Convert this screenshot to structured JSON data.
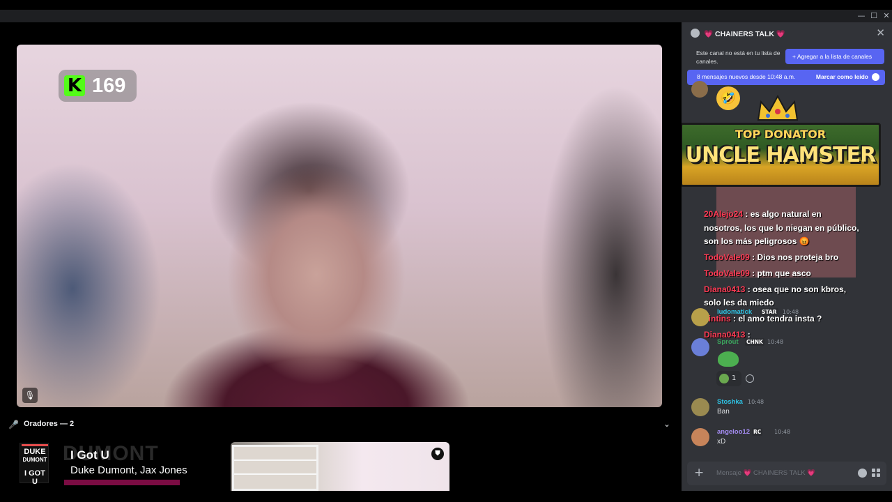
{
  "window": {
    "minimize": "—",
    "maximize": "☐",
    "close": "✕"
  },
  "stage": {
    "kick_viewers": "169",
    "kick_logo_letter": "K",
    "speakers_label": "Oradores — 2",
    "music": {
      "album_line1": "DUKE",
      "album_line2": "DUMONT",
      "album_line3": "I GOT U",
      "bg_text": "DUMONT",
      "title": "I Got U",
      "artist": "Duke Dumont, Jax Jones"
    }
  },
  "chat": {
    "title": "💗 CHAINERS TALK 💗",
    "notice_text": "Este canal no está en tu lista de canales.",
    "add_button": "+ Agregar a la lista de canales",
    "new_messages": "8 mensajes nuevos desde 10:48 a.m.",
    "mark_read": "Marcar como leído",
    "laugh_emoji": "🤣",
    "donor_top": "TOP DONATOR",
    "donor_name": "UNCLE HAMSTER",
    "overlay_lines": [
      {
        "name": "20Alejo24",
        "text": ": es algo natural en"
      },
      {
        "name": "",
        "text": "nosotros, los que lo niegan en público,"
      },
      {
        "name": "",
        "text": "son los más peligrosos 😡"
      },
      {
        "name": "TodoVale09",
        "text": ": Dios nos proteja bro"
      },
      {
        "name": "TodoVale09",
        "text": ": ptm que asco"
      },
      {
        "name": "Diana0413",
        "text": ": osea que no son kbros,"
      },
      {
        "name": "",
        "text": "solo les da miedo"
      },
      {
        "name": "sintins",
        "text": ": el amo tendra insta ?"
      },
      {
        "name": "Diana0413",
        "text": ":"
      }
    ],
    "messages": [
      {
        "name": "ludomatick",
        "tag": "STAR",
        "time": "10:48",
        "body": "",
        "color": "#2ec4e5"
      },
      {
        "name": "Sprout",
        "tag": "CHNK",
        "time": "10:48",
        "body": "",
        "color": "#3ba55d"
      },
      {
        "name": "Stoshka",
        "tag": "",
        "time": "10:48",
        "body": "Ban",
        "color": "#2ec4e5"
      },
      {
        "name": "angeloo12",
        "tag": "RC",
        "time": "10:48",
        "body": "xD",
        "color": "#a48cf2"
      }
    ],
    "reaction_count": "1",
    "composer_placeholder": "Mensaje 💗 CHAINERS TALK 💗"
  }
}
